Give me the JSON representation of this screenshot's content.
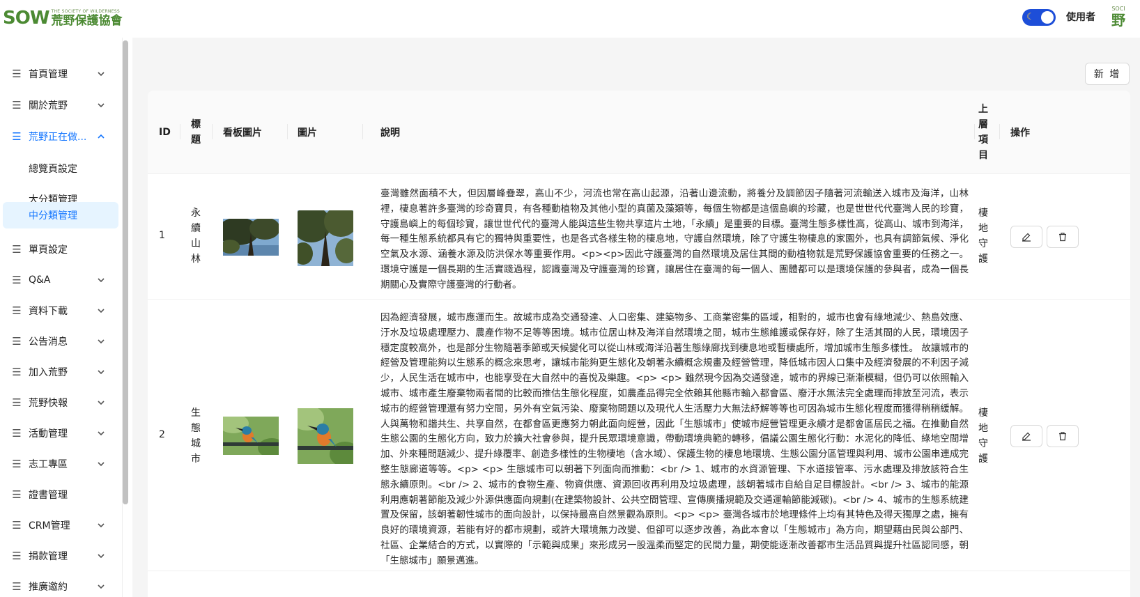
{
  "header": {
    "logo_mark": "SOW",
    "logo_subtitle": "THE SOCIETY OF WILDERNESS",
    "logo_name": "荒野保護協會",
    "user_label": "使用者",
    "avatar_text": "野",
    "avatar_small": "SOCI"
  },
  "sidebar": {
    "items": [
      {
        "label": "首頁管理"
      },
      {
        "label": "關於荒野"
      },
      {
        "label": "荒野正在做..."
      },
      {
        "label": "單頁設定"
      },
      {
        "label": "Q&A"
      },
      {
        "label": "資料下載"
      },
      {
        "label": "公告消息"
      },
      {
        "label": "加入荒野"
      },
      {
        "label": "荒野快報"
      },
      {
        "label": "活動管理"
      },
      {
        "label": "志工專區"
      },
      {
        "label": "證書管理"
      },
      {
        "label": "CRM管理"
      },
      {
        "label": "捐款管理"
      },
      {
        "label": "推廣邀約"
      }
    ],
    "submenu": [
      {
        "label": "總覽頁設定"
      },
      {
        "label": "大分類管理"
      },
      {
        "label": "中分類管理"
      }
    ]
  },
  "toolbar": {
    "add_label": "新 增"
  },
  "table": {
    "columns": {
      "id": "ID",
      "title": [
        "標",
        "題"
      ],
      "board_image": "看板圖片",
      "image": "圖片",
      "description": "說明",
      "parent": [
        "上",
        "層",
        "項",
        "目"
      ],
      "actions": "操作"
    },
    "rows": [
      {
        "id": "1",
        "title": [
          "永",
          "續",
          "山",
          "林"
        ],
        "description": "臺灣雖然面積不大，但因層峰疊翠，高山不少，河流也常在高山起源，沿著山邊流動，將養分及調節因子隨著河流輸送入城市及海洋，山林裡，棲息著許多臺灣的珍奇寶貝，有各種動植物及其他小型的真菌及藻類等，每個生物都是這個島嶼的珍藏，也是世世代代臺灣人民的珍寶，守護島嶼上的每個珍寶，讓世世代代的臺灣人能與這些生物共享這片土地，「永續」是重要的目標。臺灣生態多樣性高，從高山、城市到海洋，每一種生態系統都具有它的獨特與重要性，也是各式各樣生物的棲息地，守護自然環境，除了守護生物棲息的家園外，也具有調節氣候、淨化空氣及水源、涵養水源及防洪保水等重要作用。<p><p>因此守護臺灣的自然環境及居住其間的動植物就是荒野保護協會重要的任務之一。環境守護是一個長期的生活實踐過程，認識臺灣及守護臺灣的珍寶，讓居住在臺灣的每一個人、團體都可以是環境保護的參與者，成為一個長期關心及實際守護臺灣的行動者。",
        "parent": [
          "棲",
          "地",
          "守",
          "護"
        ]
      },
      {
        "id": "2",
        "title": [
          "生",
          "態",
          "城",
          "市"
        ],
        "description": "因為經濟發展，城市應運而生。故城市成為交通發達、人口密集、建築物多、工商業密集的區域，相對的，城市也會有綠地減少、熱島效應、汙水及垃圾處理壓力、農產作物不足等等困境。城市位居山林及海洋自然環境之間，城市生態維護或保存好，除了生活其間的人民，環境因子穩定度較高外，也是部分生物隨著季節或天候變化可以從山林或海洋沿著生態綠廊找到棲息地或暫棲處所，增加城市生態多樣性。 故讓城市的經營及管理能夠以生態系的概念來思考，讓城市能夠更生態化及朝著永續概念規畫及經營管理，降低城市因人口集中及經濟發展的不利因子減少，人民生活在城市中，也能享受在大自然中的喜悅及樂趣。<p> <p> 雖然現今因為交通發達，城市的界線已漸漸模糊，但仍可以依照輸入城市、城市產生廢棄物兩者間的比較而推估生態化程度，如農產品得完全依賴其他縣市輸入都會區、廢汙水無法完全處理而排放至河流，表示城市的經營管理還有努力空間，另外有空氣污染、廢棄物問題以及現代人生活壓力大無法紓解等等也可因為城市生態化程度而獲得稍稍緩解。人與萬物和諧共生、共享自然，在都會區更應努力朝此面向經營，因此「生態城市」使城市經營管理更永續才是都會區居民之福。在推動自然生態公園的生態化方向，致力於擴大社會參與，提升民眾環境意識，帶動環境典範的轉移，倡議公園生態化行動：水泥化的降低、綠地空間增加、外來種問題減少、提升綠覆率、創造多樣性的生物棲地（含水域）、保護生物的棲息地環境、生態公園分區管理與利用、城市公園串連成完整生態廊道等等。<p> <p> 生態城市可以朝著下列面向而推動：<br /> 1、城市的水資源管理、下水道接管率、污水處理及排放該符合生態永續原則。<br /> 2、城市的食物生產、物資供應、資源回收再利用及垃圾處理，該朝著城市自給自足目標設計。<br /> 3、城市的能源利用應朝著節能及減少外源供應面向規劃(在建築物設計、公共空間管理、宣傳廣播規範及交通運輸節能減碳)。<br /> 4、城市的生態系統建置及保留，該朝著韌性城市的面向設計，以保持最高自然景觀為原則。<p> <p> 臺灣各城市於地理條件上均有其特色及得天獨厚之處，擁有良好的環境資源，若能有好的都市規劃，或許大環境無力改變、但卻可以逐步改善，為此本會以「生態城市」為方向，期望藉由民與公部門、社區、企業結合的方式，以實際的「示範與成果」來形成另一股溫柔而堅定的民間力量，期使能逐漸改善都市生活品質與提升社區認同感，朝「生態城市」願景邁進。",
        "parent": [
          "棲",
          "地",
          "守",
          "護"
        ]
      }
    ]
  },
  "colors": {
    "accent": "#1677ff",
    "brand_green": "#4c8a33",
    "toggle": "#1d4ed8",
    "content_bg": "#f5f5f5"
  }
}
